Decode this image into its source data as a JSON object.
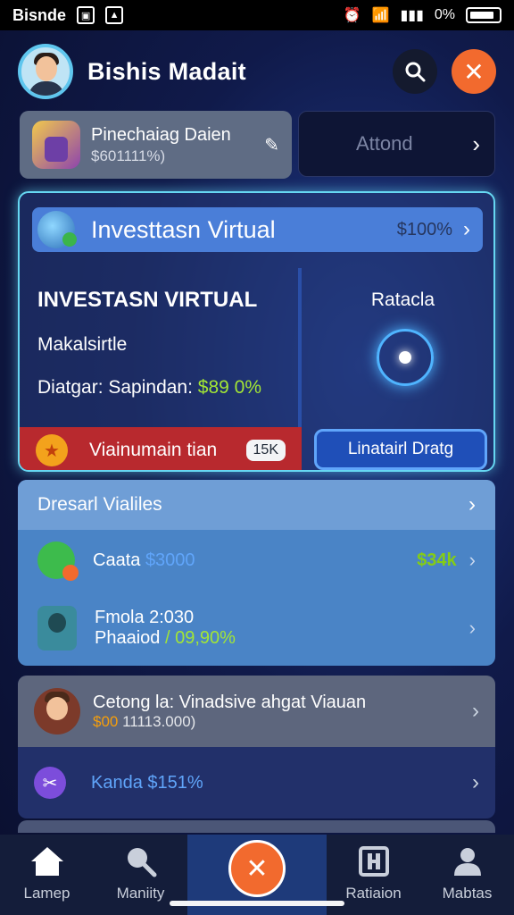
{
  "status_bar": {
    "carrier": "Bisnde",
    "right_text": "0%"
  },
  "header": {
    "title": "Bishis Madait"
  },
  "card_small": {
    "title": "Pinechaiag Daien",
    "subtitle": "$601111%)"
  },
  "card_dark": {
    "label": "Attond"
  },
  "invest": {
    "bar_title": "Investtasn Virtual",
    "bar_pct": "$100%",
    "heading": "INVESTASN VIRTUAL",
    "subheading": "Makalsirtle",
    "detail_label": "Diatgar: Sapindan: ",
    "detail_value": "$89 0%",
    "right_label": "Ratacla",
    "red_label": "Viainumain tian",
    "badge": "15K",
    "cta": "Linatairl Dratg"
  },
  "list": {
    "header": "Dresarl Vialiles",
    "row1_label": "Caata ",
    "row1_value": "$3000",
    "row1_amount": "$34k",
    "row2_line1": "Fmola 2:030",
    "row2_line2_label": "Phaaiod ",
    "row2_line2_value": "/ 09,90%"
  },
  "bottom": {
    "row1_title": "Cetong la: Vinadsive ahgat Viauan",
    "row1_sub_prefix": "$00",
    "row1_sub_rest": " 11113.000)",
    "row2_label": "Kanda $151%"
  },
  "tabs": {
    "t1": "Lamep",
    "t2": "Maniity",
    "t4": "Ratiaion",
    "t5": "Mabtas"
  },
  "colors": {
    "accent_orange": "#f26a2e",
    "accent_green": "#a3e635",
    "panel_blue": "#4a84c6"
  }
}
